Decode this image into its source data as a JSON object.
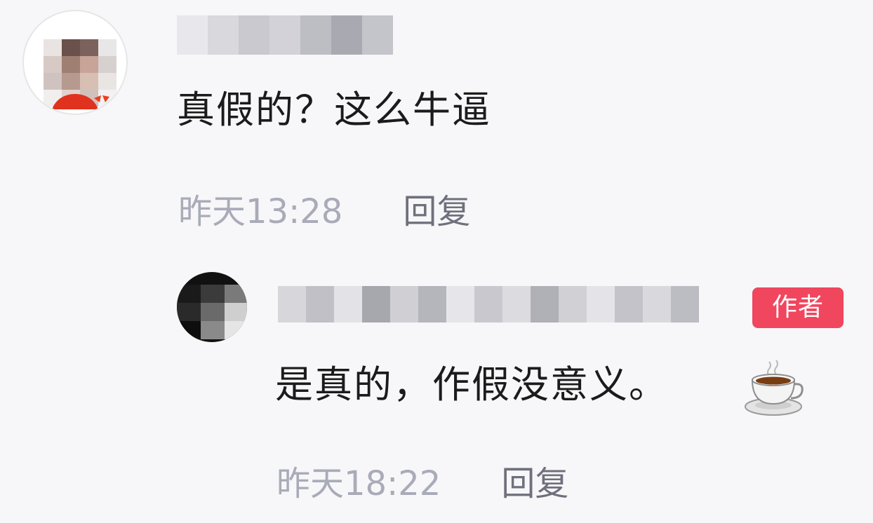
{
  "comments": [
    {
      "username": "",
      "text": "真假的？这么牛逼",
      "time": "昨天13:28",
      "reply_label": "回复"
    },
    {
      "username": "",
      "author_badge": "作者",
      "text": "是真的，作假没意义。",
      "emoji": "coffee-cup-icon",
      "time": "昨天18:22",
      "reply_label": "回复"
    }
  ],
  "colors": {
    "background": "#f7f7f9",
    "text": "#1b1b1b",
    "timestamp": "#a9abb8",
    "reply": "#6f707c",
    "author_badge": "#f0465e"
  }
}
